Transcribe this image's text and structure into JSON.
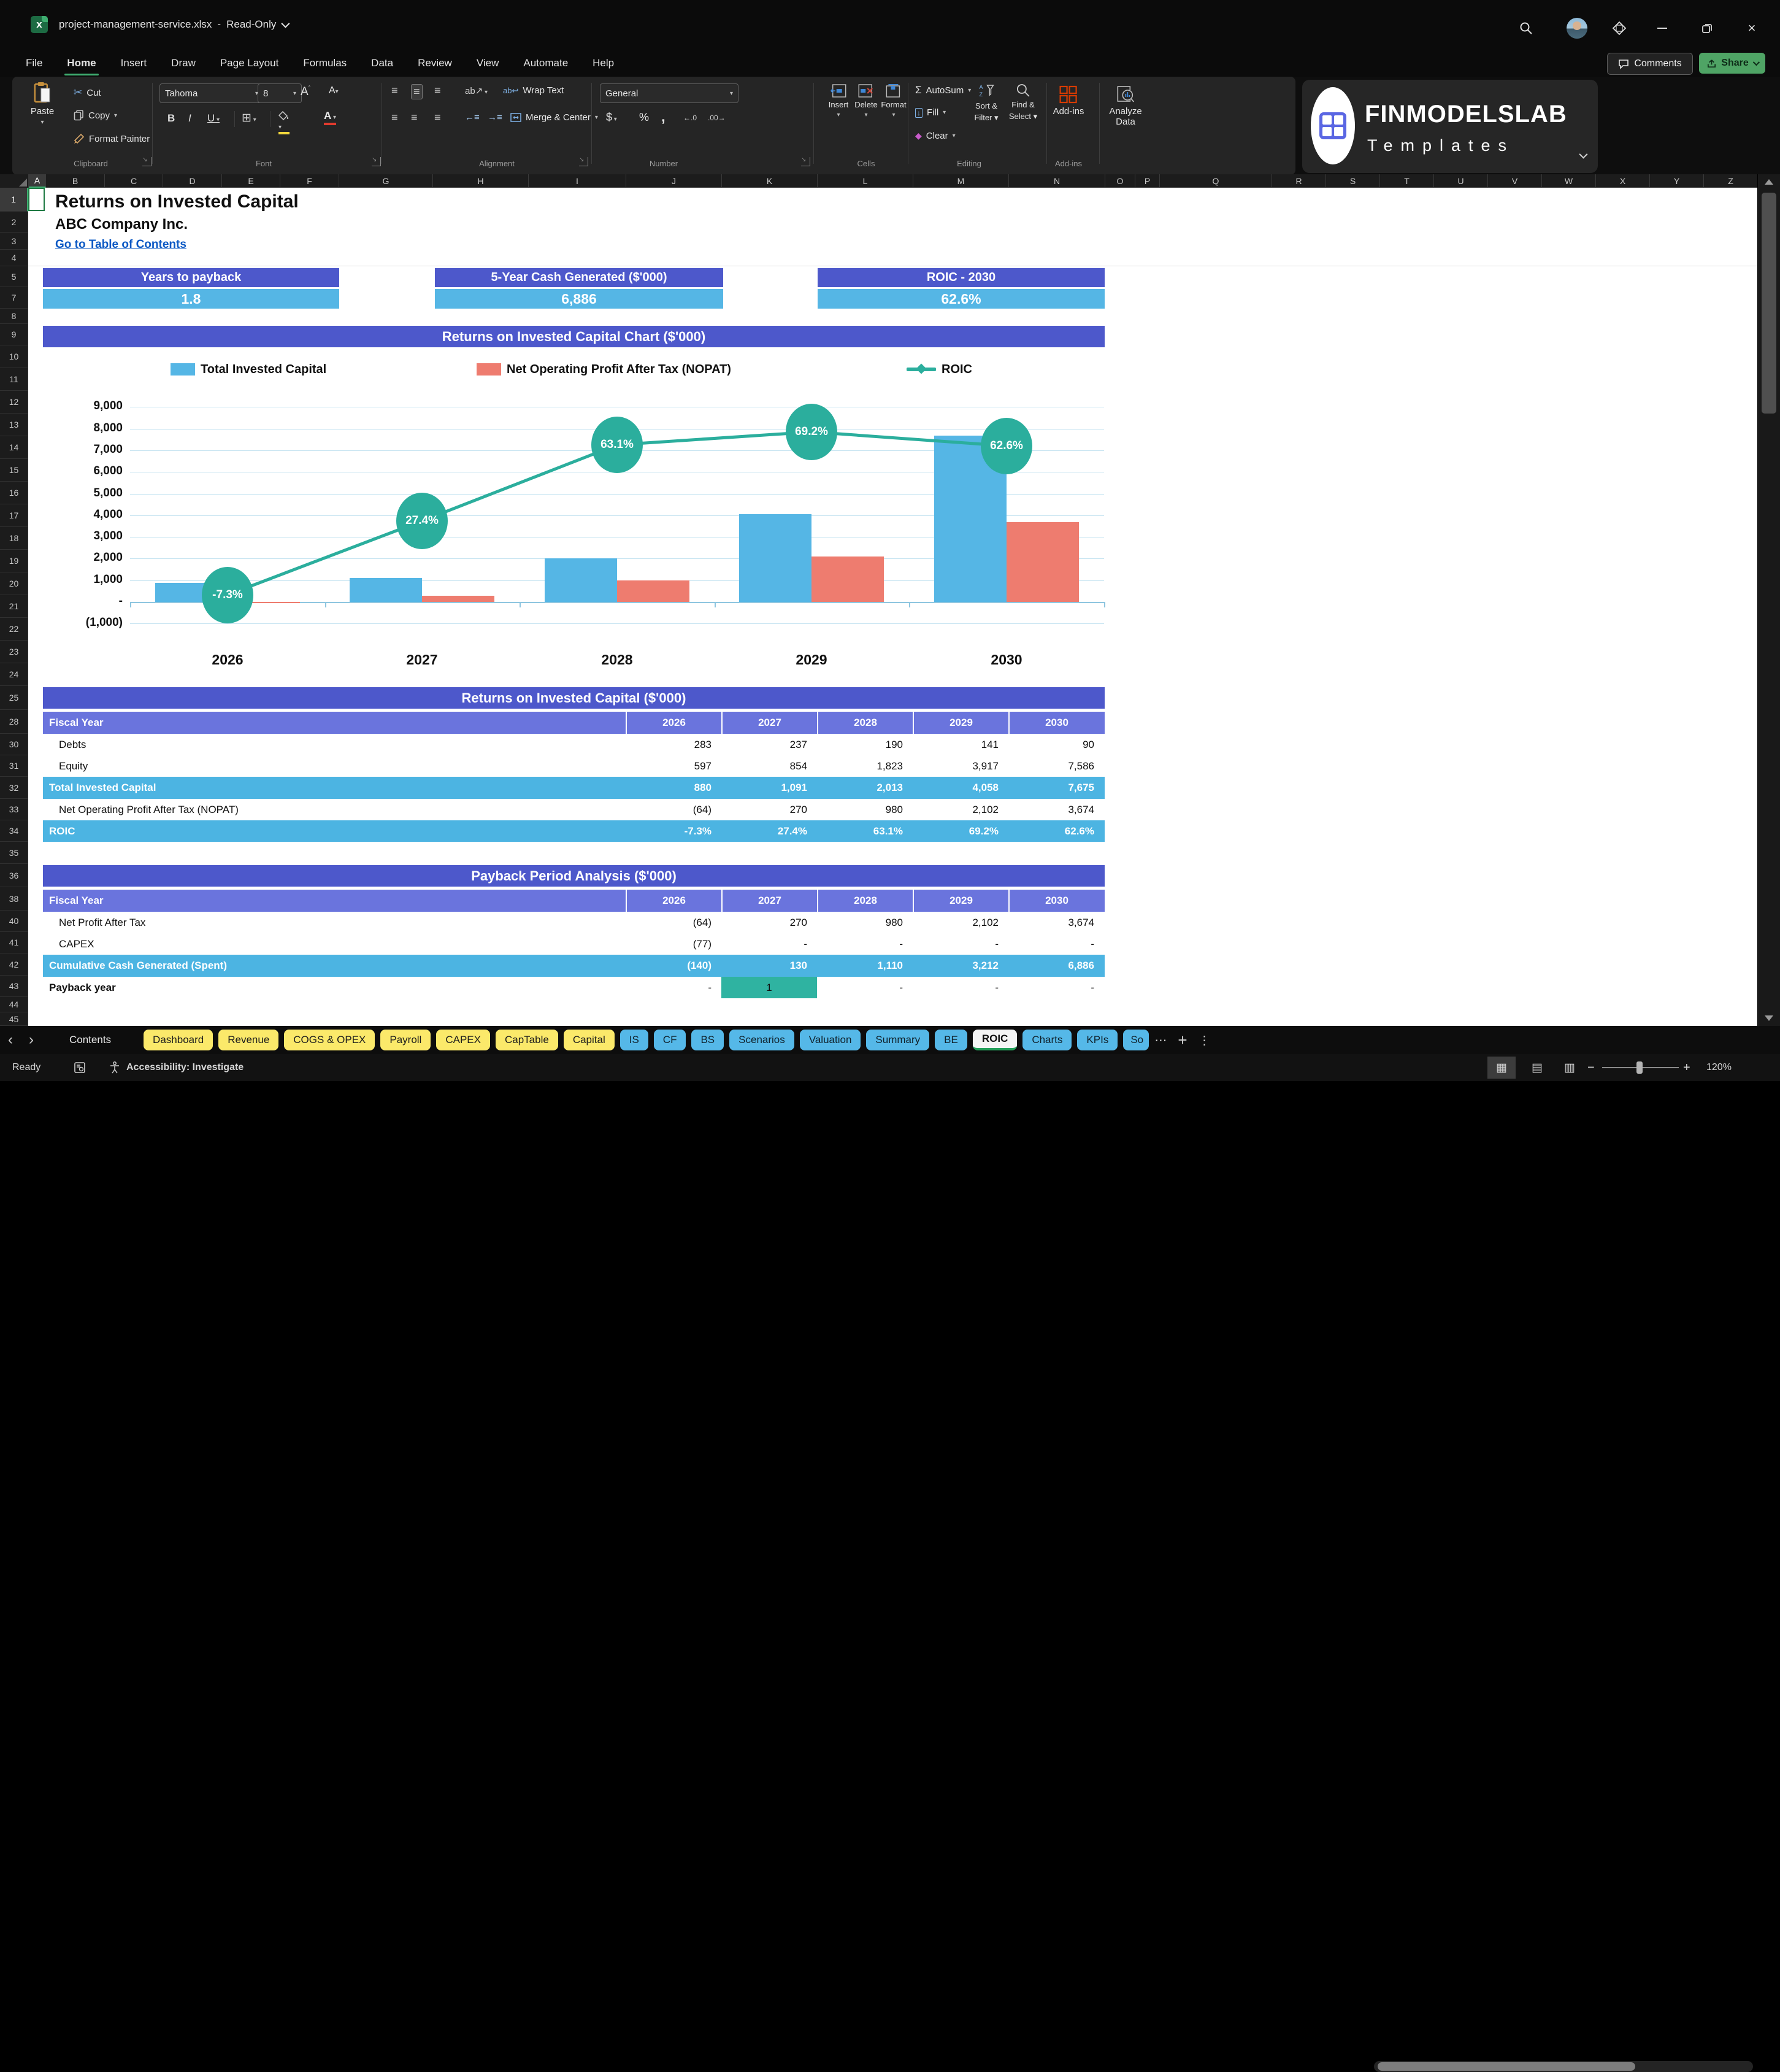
{
  "titlebar": {
    "filename": "project-management-service.xlsx",
    "separator": "-",
    "mode": "Read-Only"
  },
  "ribbon": {
    "tabs": [
      "File",
      "Home",
      "Insert",
      "Draw",
      "Page Layout",
      "Formulas",
      "Data",
      "Review",
      "View",
      "Automate",
      "Help"
    ],
    "active_tab": "Home",
    "comments": "Comments",
    "share": "Share",
    "groups": {
      "clipboard": {
        "label": "Clipboard",
        "paste": "Paste",
        "cut": "Cut",
        "copy": "Copy",
        "format_painter": "Format Painter"
      },
      "font": {
        "label": "Font",
        "family": "Tahoma",
        "size": "8",
        "bold": "B",
        "italic": "I",
        "underline": "U",
        "color_a": "A"
      },
      "alignment": {
        "label": "Alignment",
        "wrap_text": "Wrap Text",
        "merge_center": "Merge & Center",
        "orientation": "ab"
      },
      "number": {
        "label": "Number",
        "format": "General",
        "currency": "$",
        "percent": "%",
        "comma": ",",
        "inc_dec": "←.0",
        "dec_dec": ".00→"
      },
      "cells": {
        "label": "Cells",
        "insert": "Insert",
        "delete": "Delete",
        "format": "Format"
      },
      "editing": {
        "label": "Editing",
        "autosum": "AutoSum",
        "autosum_sigma": "Σ",
        "fill": "Fill",
        "clear": "Clear",
        "clear_diamond": "◆",
        "sort1": "Sort &",
        "sort2": "Filter",
        "find1": "Find &",
        "find2": "Select"
      },
      "addins": {
        "label": "Add-ins",
        "addins": "Add-ins",
        "analyze1": "Analyze",
        "analyze2": "Data"
      }
    },
    "logo": {
      "title": "FINMODELSLAB",
      "subtitle": "Templates"
    }
  },
  "grid": {
    "columns": [
      [
        "A",
        28
      ],
      [
        "B",
        96
      ],
      [
        "C",
        95
      ],
      [
        "D",
        96
      ],
      [
        "E",
        95
      ],
      [
        "F",
        96
      ],
      [
        "G",
        153
      ],
      [
        "H",
        156
      ],
      [
        "I",
        159
      ],
      [
        "J",
        156
      ],
      [
        "K",
        156
      ],
      [
        "L",
        156
      ],
      [
        "M",
        156
      ],
      [
        "N",
        157
      ],
      [
        "O",
        49
      ],
      [
        "P",
        40
      ],
      [
        "Q",
        183
      ],
      [
        "R",
        88
      ],
      [
        "S",
        88
      ],
      [
        "T",
        88
      ],
      [
        "U",
        88
      ],
      [
        "V",
        88
      ],
      [
        "W",
        88
      ],
      [
        "X",
        88
      ],
      [
        "Y",
        88
      ],
      [
        "Z",
        88
      ]
    ],
    "rows": [
      [
        1,
        39
      ],
      [
        2,
        34
      ],
      [
        3,
        28
      ],
      [
        4,
        27
      ],
      [
        5,
        34
      ],
      [
        7,
        35
      ],
      [
        8,
        25
      ],
      [
        9,
        35
      ],
      [
        10,
        37
      ],
      [
        11,
        37
      ],
      [
        12,
        37
      ],
      [
        13,
        37
      ],
      [
        14,
        37
      ],
      [
        15,
        37
      ],
      [
        16,
        37
      ],
      [
        17,
        37
      ],
      [
        18,
        37
      ],
      [
        19,
        37
      ],
      [
        20,
        37
      ],
      [
        21,
        37
      ],
      [
        22,
        37
      ],
      [
        23,
        37
      ],
      [
        24,
        37
      ],
      [
        25,
        39
      ],
      [
        28,
        39
      ],
      [
        30,
        35
      ],
      [
        31,
        35
      ],
      [
        32,
        36
      ],
      [
        33,
        35
      ],
      [
        34,
        35
      ],
      [
        35,
        36
      ],
      [
        36,
        38
      ],
      [
        38,
        38
      ],
      [
        40,
        35
      ],
      [
        41,
        35
      ],
      [
        42,
        36
      ],
      [
        43,
        35
      ],
      [
        44,
        25
      ],
      [
        45,
        22
      ]
    ],
    "selected_column": "A",
    "selected_row": 1
  },
  "sheet": {
    "title": "Returns on Invested Capital",
    "company": "ABC Company Inc.",
    "link": "Go to Table of Contents",
    "kpis": [
      {
        "label": "Years to payback",
        "value": "1.8"
      },
      {
        "label": "5-Year Cash Generated ($'000)",
        "value": "6,886"
      },
      {
        "label": "ROIC - 2030",
        "value": "62.6%"
      }
    ]
  },
  "chart_data": {
    "type": "bar+line",
    "title": "Returns on Invested Capital Chart ($'000)",
    "categories": [
      "2026",
      "2027",
      "2028",
      "2029",
      "2030"
    ],
    "series": [
      {
        "name": "Total Invested Capital",
        "type": "bar",
        "color": "#55b6e5",
        "values": [
          880,
          1091,
          2013,
          4058,
          7675
        ]
      },
      {
        "name": "Net Operating Profit After Tax (NOPAT)",
        "type": "bar",
        "color": "#ee7c6f",
        "values": [
          -64,
          270,
          980,
          2102,
          3674
        ]
      },
      {
        "name": "ROIC",
        "type": "line",
        "color": "#2bae9d",
        "values_percent": [
          -7.3,
          27.4,
          63.1,
          69.2,
          62.6
        ],
        "point_labels": [
          "-7.3%",
          "27.4%",
          "63.1%",
          "69.2%",
          "62.6%"
        ]
      }
    ],
    "y_axis": {
      "range": [
        -1000,
        9000
      ],
      "ticks": [
        {
          "v": 9000,
          "label": "9,000"
        },
        {
          "v": 8000,
          "label": "8,000"
        },
        {
          "v": 7000,
          "label": "7,000"
        },
        {
          "v": 6000,
          "label": "6,000"
        },
        {
          "v": 5000,
          "label": "5,000"
        },
        {
          "v": 4000,
          "label": "4,000"
        },
        {
          "v": 3000,
          "label": "3,000"
        },
        {
          "v": 2000,
          "label": "2,000"
        },
        {
          "v": 1000,
          "label": "1,000"
        },
        {
          "v": 0,
          "label": "-"
        },
        {
          "v": -1000,
          "label": "(1,000)"
        }
      ]
    },
    "grid": true,
    "legend_position": "top"
  },
  "tables": [
    {
      "title": "Returns on Invested Capital ($'000)",
      "header": [
        "Fiscal Year",
        "2026",
        "2027",
        "2028",
        "2029",
        "2030"
      ],
      "rows": [
        {
          "label": "Debts",
          "values": [
            "283",
            "237",
            "190",
            "141",
            "90"
          ],
          "style": "plain",
          "indent": true
        },
        {
          "label": "Equity",
          "values": [
            "597",
            "854",
            "1,823",
            "3,917",
            "7,586"
          ],
          "style": "plain",
          "indent": true
        },
        {
          "label": "Total Invested Capital",
          "values": [
            "880",
            "1,091",
            "2,013",
            "4,058",
            "7,675"
          ],
          "style": "highlight"
        },
        {
          "label": "Net Operating Profit After Tax (NOPAT)",
          "values": [
            "(64)",
            "270",
            "980",
            "2,102",
            "3,674"
          ],
          "style": "plain",
          "indent": true
        },
        {
          "label": "ROIC",
          "values": [
            "-7.3%",
            "27.4%",
            "63.1%",
            "69.2%",
            "62.6%"
          ],
          "style": "highlight"
        }
      ]
    },
    {
      "title": "Payback Period Analysis ($'000)",
      "header": [
        "Fiscal Year",
        "2026",
        "2027",
        "2028",
        "2029",
        "2030"
      ],
      "rows": [
        {
          "label": "Net Profit After Tax",
          "values": [
            "(64)",
            "270",
            "980",
            "2,102",
            "3,674"
          ],
          "style": "plain",
          "indent": true
        },
        {
          "label": "CAPEX",
          "values": [
            "(77)",
            "-",
            "-",
            "-",
            "-"
          ],
          "style": "plain",
          "indent": true
        },
        {
          "label": "Cumulative Cash Generated (Spent)",
          "values": [
            "(140)",
            "130",
            "1,110",
            "3,212",
            "6,886"
          ],
          "style": "highlight"
        },
        {
          "label": "Payback year",
          "values": [
            "-",
            "1",
            "-",
            "-",
            "-"
          ],
          "style": "plain",
          "bold_label": true,
          "cell_fill": {
            "col": 1,
            "color": "#2fb3a1"
          }
        }
      ]
    }
  ],
  "sheet_tabs": {
    "items": [
      {
        "label": "Contents",
        "type": "plain"
      },
      {
        "label": "Dashboard",
        "type": "yellow"
      },
      {
        "label": "Revenue",
        "type": "yellow"
      },
      {
        "label": "COGS & OPEX",
        "type": "yellow"
      },
      {
        "label": "Payroll",
        "type": "yellow"
      },
      {
        "label": "CAPEX",
        "type": "yellow"
      },
      {
        "label": "CapTable",
        "type": "yellow"
      },
      {
        "label": "Capital",
        "type": "yellow"
      },
      {
        "label": "IS",
        "type": "blue"
      },
      {
        "label": "CF",
        "type": "blue"
      },
      {
        "label": "BS",
        "type": "blue"
      },
      {
        "label": "Scenarios",
        "type": "blue"
      },
      {
        "label": "Valuation",
        "type": "blue"
      },
      {
        "label": "Summary",
        "type": "blue"
      },
      {
        "label": "BE",
        "type": "blue"
      },
      {
        "label": "ROIC",
        "type": "active"
      },
      {
        "label": "Charts",
        "type": "blue"
      },
      {
        "label": "KPIs",
        "type": "blue"
      },
      {
        "label": "So",
        "type": "blue",
        "clipped": true
      }
    ],
    "more": "⋯",
    "add": "+",
    "menu": "⋮"
  },
  "status_bar": {
    "ready": "Ready",
    "accessibility": "Accessibility: Investigate",
    "zoom_minus": "−",
    "zoom_plus": "+",
    "zoom_level": "120%"
  }
}
